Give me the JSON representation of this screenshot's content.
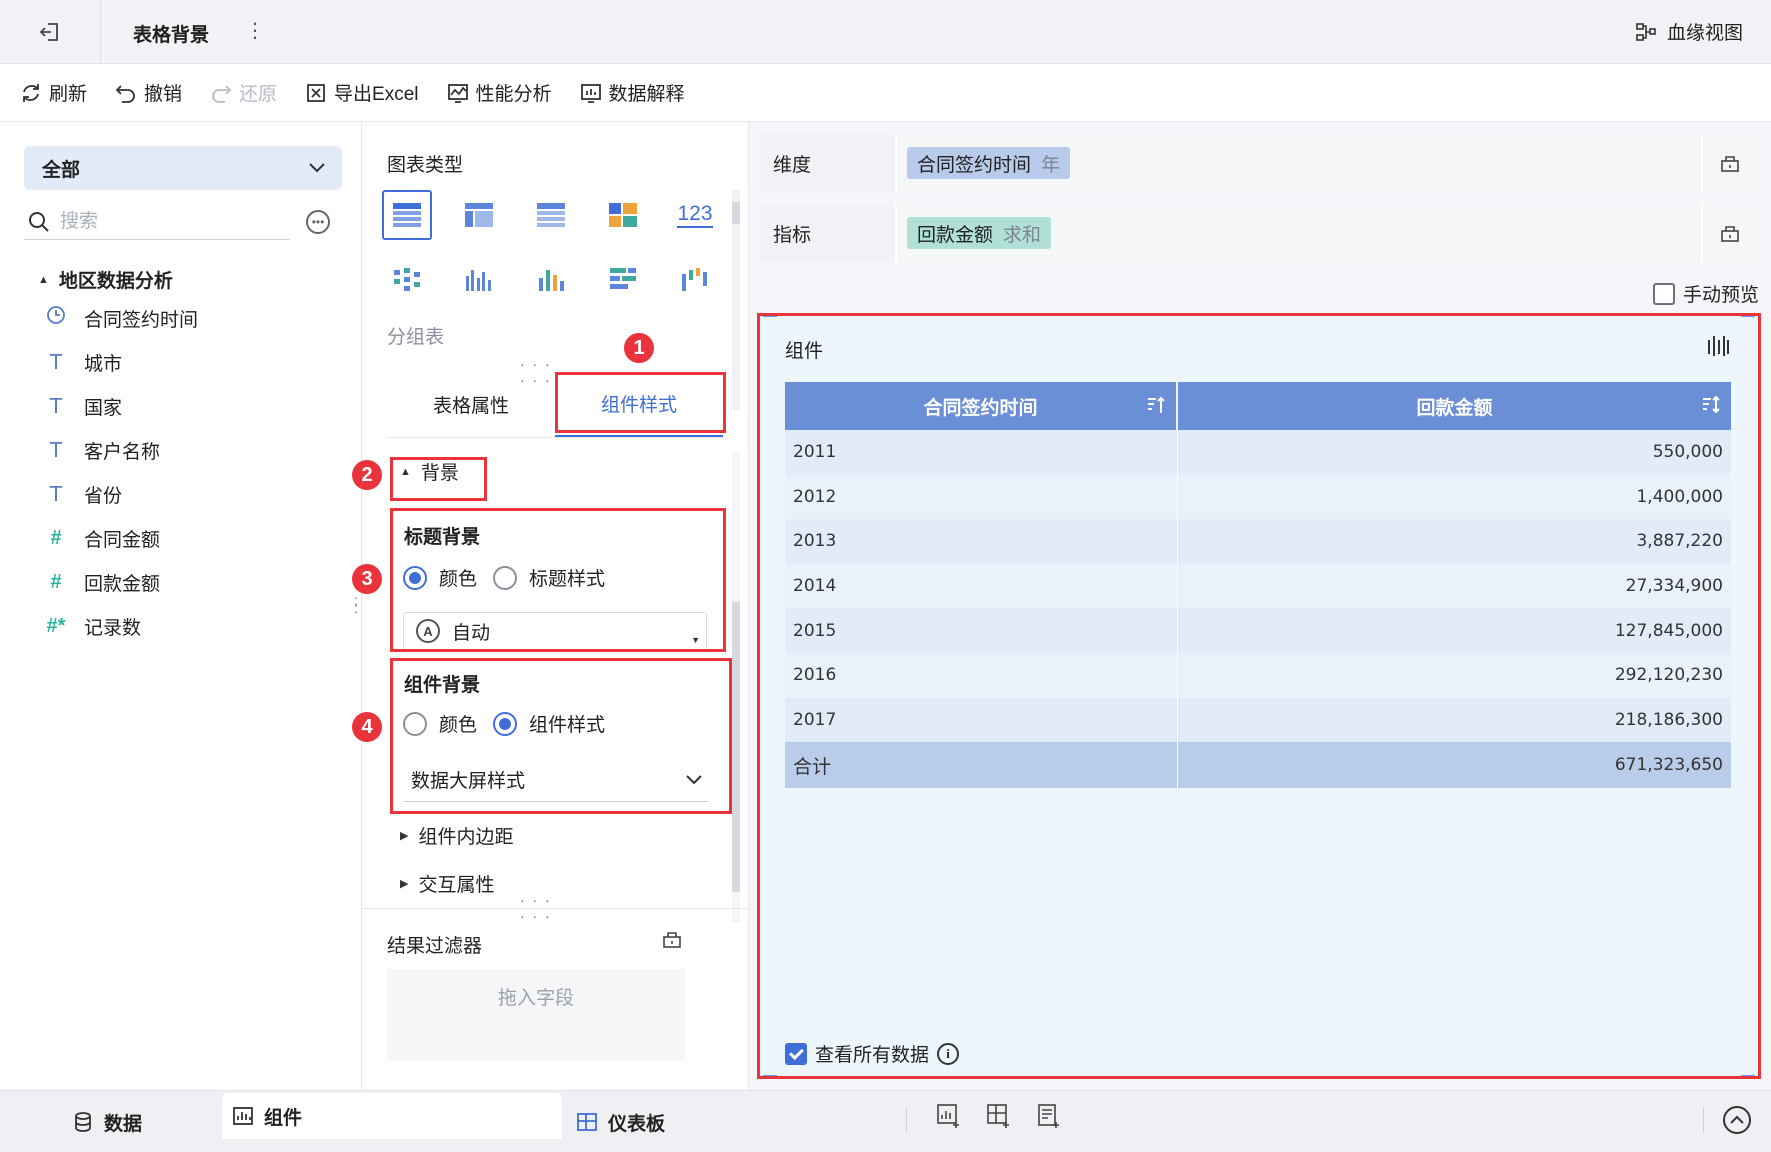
{
  "header": {
    "title": "表格背景",
    "more_label": "⋮",
    "lineage_label": "血缘视图"
  },
  "toolbar": {
    "refresh": "刷新",
    "undo": "撤销",
    "redo": "还原",
    "export": "导出Excel",
    "perf": "性能分析",
    "explain": "数据解释"
  },
  "left": {
    "scope": "全部",
    "search_placeholder": "搜索",
    "dataset": "地区数据分析",
    "fields": [
      {
        "label": "合同签约时间",
        "type": "date",
        "icon": "clock-icon"
      },
      {
        "label": "城市",
        "type": "text",
        "icon": "T"
      },
      {
        "label": "国家",
        "type": "text",
        "icon": "T"
      },
      {
        "label": "客户名称",
        "type": "text",
        "icon": "T"
      },
      {
        "label": "省份",
        "type": "text",
        "icon": "T"
      },
      {
        "label": "合同金额",
        "type": "number",
        "icon": "#"
      },
      {
        "label": "回款金额",
        "type": "number",
        "icon": "#"
      },
      {
        "label": "记录数",
        "type": "number",
        "icon": "#*"
      }
    ]
  },
  "middle": {
    "chart_type_label": "图表类型",
    "chart_type_name": "分组表",
    "chart_123": "123",
    "tabs": [
      "表格属性",
      "组件样式"
    ],
    "active_tab": 1,
    "background_section": "背景",
    "title_bg": {
      "label": "标题背景",
      "options": [
        "颜色",
        "标题样式"
      ],
      "selected": 0,
      "select_value": "自动",
      "auto_icon_letter": "A"
    },
    "widget_bg": {
      "label": "组件背景",
      "options": [
        "颜色",
        "组件样式"
      ],
      "selected": 1,
      "select_value": "数据大屏样式"
    },
    "padding_section": "组件内边距",
    "interaction_section": "交互属性",
    "filter_title": "结果过滤器",
    "drop_hint": "拖入字段",
    "markers": [
      "1",
      "2",
      "3",
      "4"
    ]
  },
  "right": {
    "dimension_label": "维度",
    "dimension_pill": {
      "name": "合同签约时间",
      "agg": "年"
    },
    "measure_label": "指标",
    "measure_pill": {
      "name": "回款金额",
      "agg": "求和"
    },
    "manual_preview": "手动预览",
    "manual_preview_checked": false,
    "widget_title": "组件",
    "table": {
      "headers": [
        "合同签约时间",
        "回款金额"
      ],
      "rows": [
        [
          "2011",
          "550,000"
        ],
        [
          "2012",
          "1,400,000"
        ],
        [
          "2013",
          "3,887,220"
        ],
        [
          "2014",
          "27,334,900"
        ],
        [
          "2015",
          "127,845,000"
        ],
        [
          "2016",
          "292,120,230"
        ],
        [
          "2017",
          "218,186,300"
        ]
      ],
      "total": [
        "合计",
        "671,323,650"
      ]
    },
    "view_all": "查看所有数据",
    "view_all_checked": true,
    "info_letter": "i"
  },
  "bottom": {
    "tabs": [
      "数据",
      "组件",
      "仪表板"
    ],
    "active_tab": 1
  },
  "colors": {
    "accent": "#3f6ed8",
    "header_row": "#6a8fd6",
    "annotation_red": "#e8343a",
    "dimension_pill": "#b9cbea",
    "measure_pill": "#b1e0d6"
  }
}
